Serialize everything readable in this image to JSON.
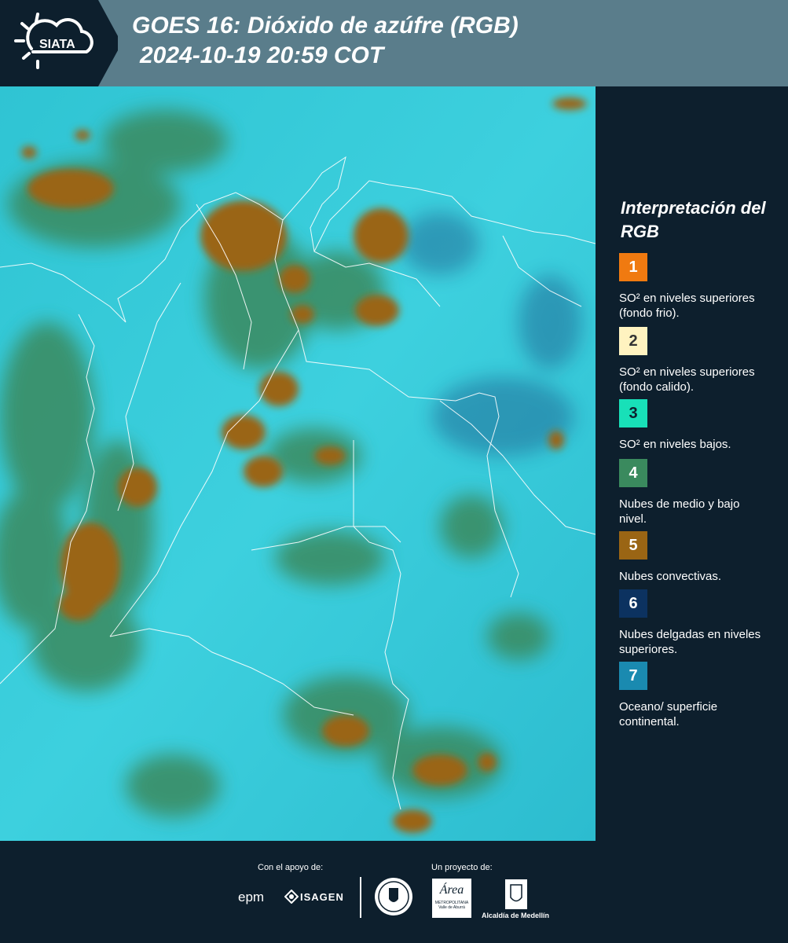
{
  "header": {
    "logo_text": "SIATA",
    "title_line1": "GOES 16: Dióxido de azúfre (RGB)",
    "title_line2": "2024-10-19 20:59 COT"
  },
  "legend": {
    "title": "Interpretación del RGB",
    "items": [
      {
        "number": "1",
        "color": "#f07a10",
        "label": "SO² en niveles superiores (fondo frio)."
      },
      {
        "number": "2",
        "color": "#fff3c0",
        "label": "SO² en niveles superiores (fondo calido)."
      },
      {
        "number": "3",
        "color": "#18e0b8",
        "label": "SO² en niveles bajos."
      },
      {
        "number": "4",
        "color": "#3a8a5e",
        "label": "Nubes de medio y bajo nivel."
      },
      {
        "number": "5",
        "color": "#9a6514",
        "label": "Nubes convectivas."
      },
      {
        "number": "6",
        "color": "#0c3260",
        "label": "Nubes delgadas en niveles superiores."
      },
      {
        "number": "7",
        "color": "#1a8ab0",
        "label": "Oceano/ superficie continental."
      }
    ]
  },
  "footer": {
    "support_label": "Con el apoyo de:",
    "project_label": "Un proyecto de:",
    "epm": "epm",
    "isagen": "ISAGEN",
    "metro_line1": "Área",
    "metro_line2": "METROPOLITANA",
    "metro_line3": "Valle de Aburrá",
    "alcaldia": "Alcaldía de Medellín"
  },
  "colors": {
    "header_bg": "#5a7d8b",
    "panel_bg": "#0d1f2d",
    "cloud_convective": "#9a6514",
    "cloud_low": "#3a8a5e",
    "surface": "#34c8d8"
  }
}
